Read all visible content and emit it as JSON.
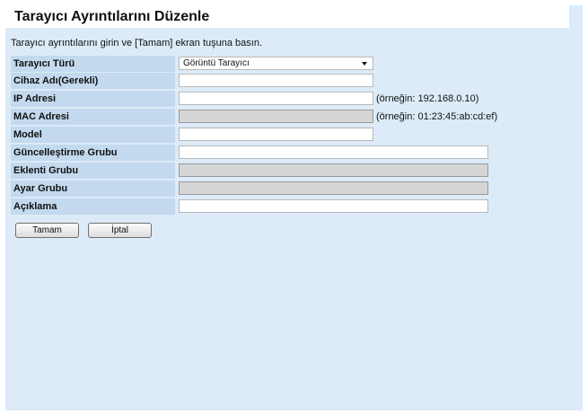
{
  "page_title": "Tarayıcı Ayrıntılarını Düzenle",
  "instruction": "Tarayıcı ayrıntılarını girin ve [Tamam] ekran tuşuna basın.",
  "form": {
    "scanner_type": {
      "label": "Tarayıcı Türü",
      "value": "Görüntü Tarayıcı"
    },
    "device_name": {
      "label": "Cihaz Adı(Gerekli)",
      "value": ""
    },
    "ip_address": {
      "label": "IP Adresi",
      "value": "",
      "hint": "(örneğin: 192.168.0.10)"
    },
    "mac_address": {
      "label": "MAC Adresi",
      "value": "",
      "hint": "(örneğin: 01:23:45:ab:cd:ef)"
    },
    "model": {
      "label": "Model",
      "value": ""
    },
    "update_group": {
      "label": "Güncelleştirme Grubu",
      "value": ""
    },
    "addon_group": {
      "label": "Eklenti Grubu",
      "value": ""
    },
    "settings_group": {
      "label": "Ayar Grubu",
      "value": ""
    },
    "description": {
      "label": "Açıklama",
      "value": ""
    }
  },
  "buttons": {
    "ok": "Tamam",
    "cancel": "İptal"
  }
}
